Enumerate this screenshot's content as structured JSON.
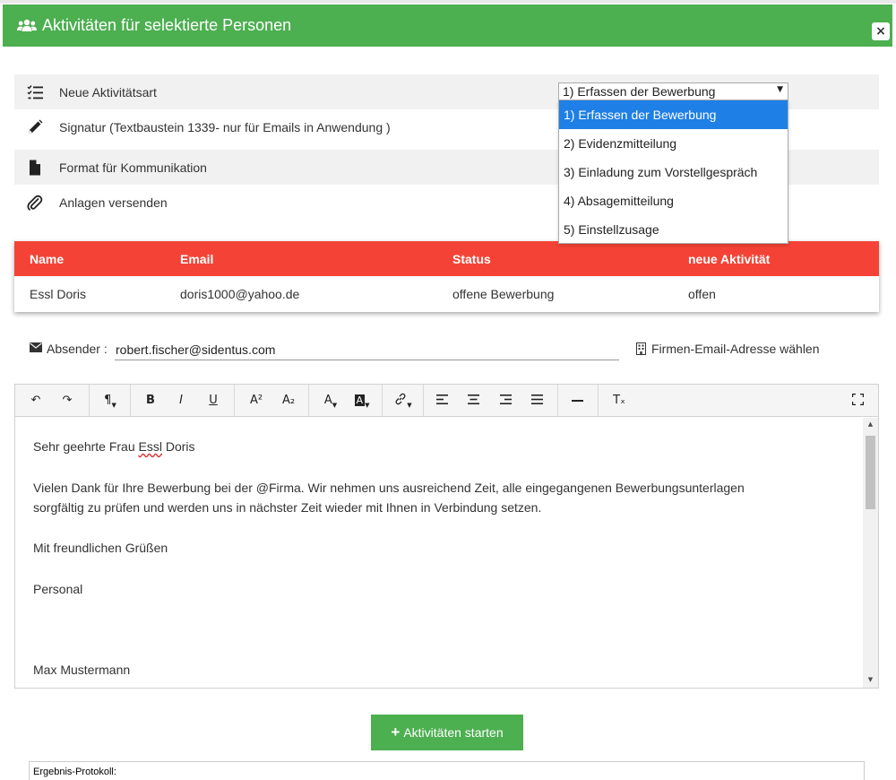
{
  "modal": {
    "title": "Aktivitäten für selektierte Personen",
    "close_label": "×",
    "header_color": "#4caf50"
  },
  "options": [
    {
      "label": "Neue Aktivitätsart",
      "icon": "checklist-icon"
    },
    {
      "label": "Signatur (Textbaustein 1339- nur für Emails in Anwendung )",
      "icon": "pencil-icon"
    },
    {
      "label": "Format für Kommunikation",
      "icon": "document-icon"
    },
    {
      "label": "Anlagen versenden",
      "icon": "paperclip-icon"
    }
  ],
  "activity_select": {
    "value": "1) Erfassen der Bewerbung",
    "options": [
      "1) Erfassen der Bewerbung",
      "2) Evidenzmitteilung",
      "3) Einladung zum Vorstellgespräch",
      "4) Absagemitteilung",
      "5) Einstellzusage"
    ],
    "selected_index": 0,
    "highlight_color": "#1e7fe6"
  },
  "table": {
    "header_color": "#f44336",
    "headers": [
      "Name",
      "Email",
      "Status",
      "neue Aktivität"
    ],
    "rows": [
      [
        "Essl Doris",
        "doris1000@yahoo.de",
        "offene Bewerbung",
        "offen"
      ]
    ]
  },
  "sender": {
    "label": "Absender :",
    "value": "robert.fischer@sidentus.com",
    "company_email_link": "Firmen-Email-Adresse wählen"
  },
  "toolbar": {
    "undo": "↶",
    "redo": "↷",
    "paragraph": "¶",
    "bold": "B",
    "italic": "I",
    "underline": "U",
    "superscript": "A²",
    "subscript": "A₂",
    "font_color": "A",
    "bg_color": "A",
    "link": "🔗",
    "clear_format": "Tₓ"
  },
  "editor": {
    "lines": [
      {
        "before": "Sehr geehrte Frau ",
        "spell": "Essl",
        "after": " Doris"
      },
      {
        "text": "Vielen Dank für Ihre Bewerbung bei der @Firma. Wir nehmen uns ausreichend Zeit, alle eingegangenen Bewerbungsunterlagen"
      },
      {
        "text": "sorgfältig zu prüfen und werden uns in nächster Zeit wieder mit Ihnen in Verbindung setzen."
      },
      {
        "text": "Mit freundlichen Grüßen"
      },
      {
        "text": "Personal"
      },
      {
        "text": "Max Mustermann"
      }
    ]
  },
  "actions": {
    "start_label": "Aktivitäten starten",
    "start_color": "#4caf50"
  },
  "log": {
    "label": "Ergebnis-Protokoll:"
  }
}
